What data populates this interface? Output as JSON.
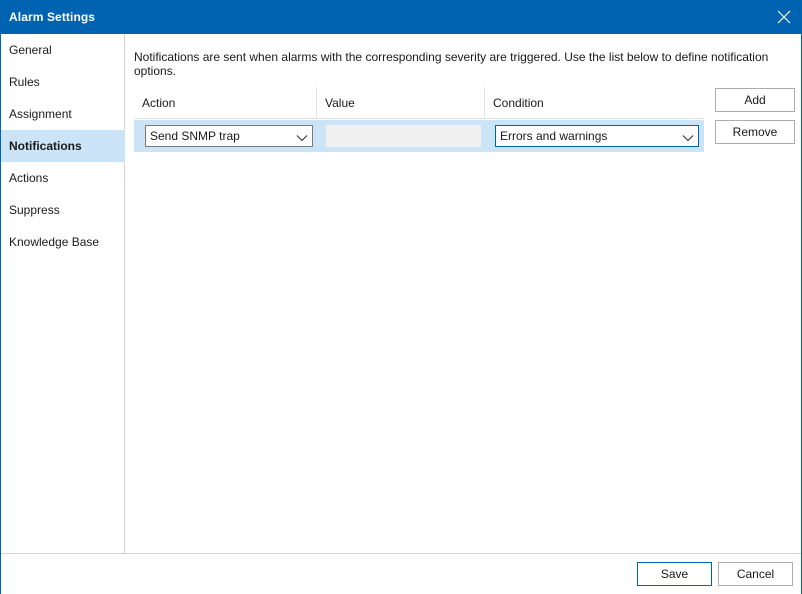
{
  "window": {
    "title": "Alarm Settings",
    "accent_color": "#0063b1",
    "selection_color": "#cce4f7",
    "close_icon": "close-icon"
  },
  "sidebar": {
    "items": [
      {
        "label": "General",
        "active": false
      },
      {
        "label": "Rules",
        "active": false
      },
      {
        "label": "Assignment",
        "active": false
      },
      {
        "label": "Notifications",
        "active": true
      },
      {
        "label": "Actions",
        "active": false
      },
      {
        "label": "Suppress",
        "active": false
      },
      {
        "label": "Knowledge Base",
        "active": false
      }
    ]
  },
  "main": {
    "description": "Notifications are sent when alarms with the corresponding severity are triggered. Use the list below to define notification options.",
    "columns": [
      "Action",
      "Value",
      "Condition"
    ],
    "rows": [
      {
        "action": "Send SNMP trap",
        "value": "",
        "condition": "Errors and warnings",
        "selected": true
      }
    ],
    "add_label": "Add",
    "remove_label": "Remove"
  },
  "footer": {
    "save_label": "Save",
    "cancel_label": "Cancel"
  }
}
